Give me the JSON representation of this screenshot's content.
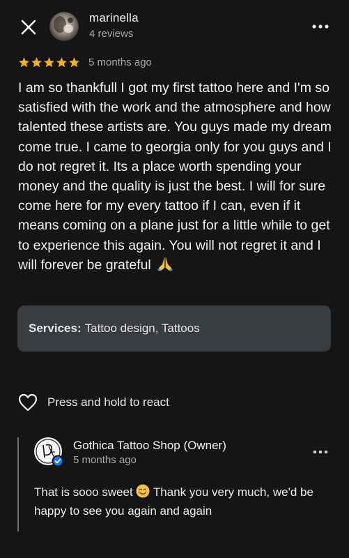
{
  "header": {
    "reviewer_name": "marinella",
    "reviewer_meta": "4 reviews"
  },
  "review": {
    "rating": 5,
    "rating_max": 5,
    "date": "5 months ago",
    "text": "I am so thankfull I got my first tattoo here and I'm so satisfied with the work and the atmosphere and how talented these artists are. You guys made my dream come true. I came to georgia only for you guys and I do not regret it. Its a place worth spending your money and the quality is just the best. I will for sure come here for my every tattoo if I can, even if it means coming on a plane just for a little while to get to experience this again. You will not regret it and I will forever be grateful"
  },
  "services": {
    "label": "Services:",
    "value": "Tattoo design, Tattoos"
  },
  "react": {
    "label": "Press and hold to react"
  },
  "owner_reply": {
    "name": "Gothica Tattoo Shop (Owner)",
    "date": "5 months ago",
    "text_before_emoji": "That is sooo sweet",
    "text_after_emoji": "Thank you very much, we'd be happy to see you again and again"
  },
  "icons": {
    "close": "close-icon",
    "more": "more-horizontal-icon",
    "star": "star-icon",
    "heart": "heart-outline-icon",
    "pray_emoji": "folded-hands-emoji",
    "smile_emoji": "smiling-face-emoji",
    "verified": "verified-badge-icon"
  },
  "colors": {
    "background": "#151515",
    "star": "#f5b21b",
    "services_bg": "#3a3d40",
    "secondary_text": "#a9a9a9",
    "verified_badge": "#1a73e8"
  }
}
